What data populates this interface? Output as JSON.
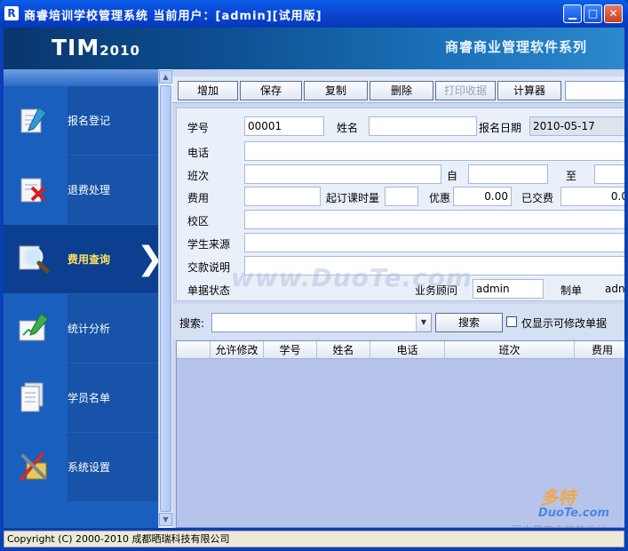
{
  "window": {
    "title": "商睿培训学校管理系统   当前用户：[admin][试用版]",
    "icon_letter": "R",
    "min_glyph": "▁",
    "max_glyph": "□",
    "close_glyph": "✕"
  },
  "banner": {
    "product": "TIM",
    "version": "2010",
    "slogan": "商睿商业管理软件系列"
  },
  "nav": {
    "items": [
      {
        "label": "报名登记",
        "icon": "register-form-icon"
      },
      {
        "label": "退费处理",
        "icon": "refund-icon"
      },
      {
        "label": "费用查询",
        "icon": "magnifier-icon",
        "active": true,
        "chevron": "❯"
      },
      {
        "label": "统计分析",
        "icon": "chart-pen-icon"
      },
      {
        "label": "学员名单",
        "icon": "document-list-icon"
      },
      {
        "label": "系统设置",
        "icon": "tools-icon"
      }
    ]
  },
  "toolbar": {
    "add": "增加",
    "save": "保存",
    "copy": "复制",
    "delete": "删除",
    "print_receipt": "打印收据",
    "calculator": "计算器"
  },
  "form": {
    "student_no_label": "学号",
    "student_no": "00001",
    "name_label": "姓名",
    "name": "",
    "signup_date_label": "报名日期",
    "signup_date": "2010-05-17",
    "phone_label": "电话",
    "class_label": "班次",
    "from_label": "自",
    "to_label": "至",
    "fee_label": "费用",
    "min_hours_label": "起订课时量",
    "discount_label": "优惠",
    "discount": "0.00",
    "paid_label": "已交费",
    "paid": "0.0",
    "campus_label": "校区",
    "source_label": "学生来源",
    "payment_note_label": "交款说明",
    "doc_status_label": "单据状态",
    "advisor_label": "业务顾问",
    "advisor": "admin",
    "maker_label": "制单",
    "maker": "adn"
  },
  "search": {
    "label": "搜索:",
    "button": "搜索",
    "editable_only_label": "仅显示可修改单据"
  },
  "grid": {
    "columns": [
      "允许修改",
      "学号",
      "姓名",
      "电话",
      "班次",
      "费用"
    ]
  },
  "status": {
    "copyright": "Copyright (C) 2000-2010  成都晒瑞科技有限公司"
  },
  "watermarks": {
    "center": "www.DuoTe.com",
    "logo_top": "多特",
    "logo_mid": "DuoTe.com",
    "logo_bottom": "国内最安全的软件站"
  }
}
